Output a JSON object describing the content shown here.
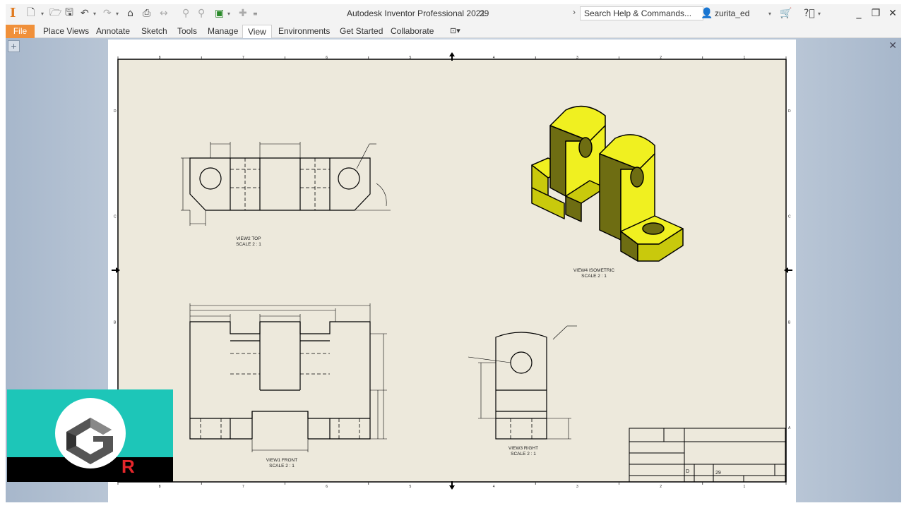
{
  "app": {
    "title": "Autodesk Inventor Professional 2021",
    "document_name": "29",
    "search_placeholder": "Search Help & Commands...",
    "user": "zurita_ed"
  },
  "ribbon": {
    "file_label": "File",
    "tabs": [
      {
        "label": "Place Views",
        "active": false
      },
      {
        "label": "Annotate",
        "active": false
      },
      {
        "label": "Sketch",
        "active": false
      },
      {
        "label": "Tools",
        "active": false
      },
      {
        "label": "Manage",
        "active": false
      },
      {
        "label": "View",
        "active": true
      },
      {
        "label": "Environments",
        "active": false
      },
      {
        "label": "Get Started",
        "active": false
      },
      {
        "label": "Collaborate",
        "active": false
      }
    ]
  },
  "drawing": {
    "views": {
      "top": {
        "name": "VIEW2 TOP",
        "scale": "SCALE 2 : 1"
      },
      "front": {
        "name": "VIEW1 FRONT",
        "scale": "SCALE 2 : 1"
      },
      "right": {
        "name": "VIEW3 RIGHT",
        "scale": "SCALE 2 : 1"
      },
      "iso": {
        "name": "VIEW4 ISOMETRIC",
        "scale": "SCALE 2 : 1"
      }
    },
    "border_numbers": [
      "8",
      "7",
      "6",
      "5",
      "4",
      "3",
      "2",
      "1"
    ],
    "border_letters": [
      "D",
      "C",
      "B",
      "A"
    ],
    "title_block": {
      "size": "D",
      "number": "29"
    },
    "colors": {
      "sheet": "#ede9dc",
      "iso_light": "#f0f020",
      "iso_mid": "#c9c90c",
      "iso_dark": "#6e6d12"
    }
  },
  "logo": {
    "letter_g": "G",
    "letter_r": "R",
    "colors": {
      "teal": "#1dc6b8",
      "red": "#e4262b"
    }
  }
}
